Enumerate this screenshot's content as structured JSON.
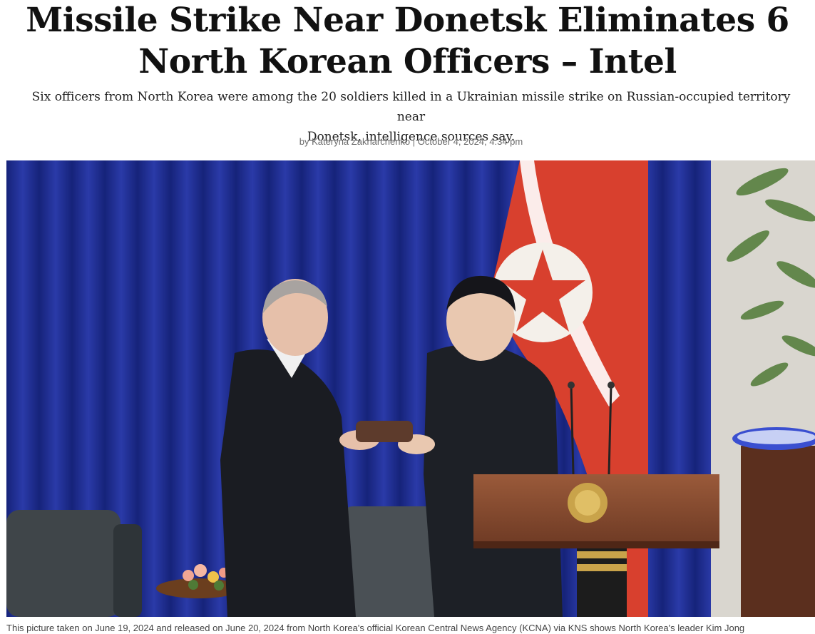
{
  "article": {
    "headline_line1": "Missile Strike Near Donetsk Eliminates 6",
    "headline_line2": "North Korean Officers – Intel",
    "subhead_line1": "Six officers from North Korea were among the 20 soldiers killed in a Ukrainian missile strike on Russian-occupied territory near",
    "subhead_line2": "Donetsk, intelligence sources say.",
    "byline": {
      "prefix": "by",
      "author": "Kateryna Zakharchenko",
      "separator": "|",
      "date": "October 4, 2024, 4:34 pm"
    },
    "photo": {
      "caption": "This picture taken on June 19, 2024 and released on June 20, 2024 from North Korea's official Korean Central News Agency (KCNA) via KNS shows North Korea's leader Kim Jong"
    }
  }
}
